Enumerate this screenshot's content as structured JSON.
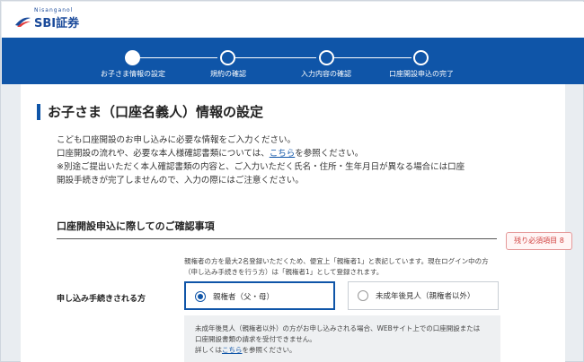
{
  "header": {
    "logo_small": "Nisanganol",
    "logo_text": "SBI証券"
  },
  "steps": [
    {
      "label": "お子さま情報の設定",
      "active": true
    },
    {
      "label": "規約の確認",
      "active": false
    },
    {
      "label": "入力内容の確認",
      "active": false
    },
    {
      "label": "口座開設申込の完了",
      "active": false
    }
  ],
  "main": {
    "title": "お子さま（口座名義人）情報の設定",
    "intro_line1": "こども口座開設のお申し込みに必要な情報をご入力ください。",
    "intro_line2_before": "口座開設の流れや、必要な本人様確認書類については、",
    "intro_line2_link": "こちら",
    "intro_line2_after": "を参照ください。",
    "intro_line3": "※別途ご提出いただく本人確認書類の内容と、ご入力いただく氏名・住所・生年月日が異なる場合には口座",
    "intro_line4": "開設手続きが完了しませんので、入力の際にはご注意ください。"
  },
  "confirm_section": {
    "title": "口座開設申込に際してのご確認事項",
    "required_badge": "残り必須項目 8",
    "note_line1": "親権者の方を最大2名登録いただくため、便宜上「親権者1」と表記しています。現在ログイン中の方",
    "note_line2": "（申し込み手続きを行う方）は「親権者1」として登録されます。",
    "field_label": "申し込み手続きされる方",
    "options": [
      {
        "label": "親権者（父・母）",
        "selected": true
      },
      {
        "label": "未成年後見人（親権者以外）",
        "selected": false
      }
    ],
    "info_line1": "未成年後見人（親権者以外）の方がお申し込みされる場合、WEBサイト上での口座開設または",
    "info_line2": "口座開設書類の請求を受付できません。",
    "info_line3_before": "詳しくは",
    "info_line3_link": "こちら",
    "info_line3_after": "を参照ください。"
  },
  "colors": {
    "brand_blue": "#0f55a8",
    "badge_red": "#d0413f"
  }
}
